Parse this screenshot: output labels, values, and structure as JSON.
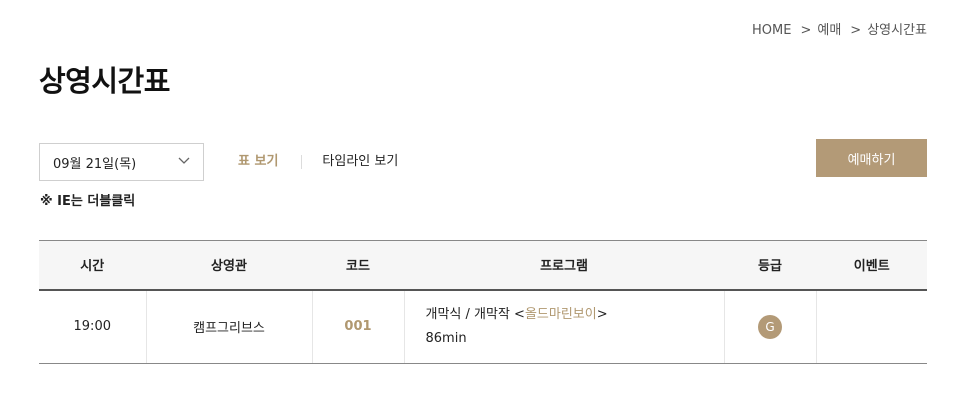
{
  "breadcrumb": {
    "items": [
      "HOME",
      "예매",
      "상영시간표"
    ],
    "separator": ">"
  },
  "page": {
    "title": "상영시간표"
  },
  "controls": {
    "date_value": "09월 21일(목)",
    "tabs": [
      {
        "label": "표 보기",
        "active": true
      },
      {
        "label": "타임라인 보기",
        "active": false
      }
    ],
    "ie_note": "※ IE는 더블클릭",
    "reserve_label": "예매하기"
  },
  "table": {
    "headers": [
      "시간",
      "상영관",
      "코드",
      "프로그램",
      "등급",
      "이벤트"
    ],
    "rows": [
      {
        "time": "19:00",
        "venue": "캠프그리브스",
        "code": "001",
        "program_prefix": "개막식 / 개막작 <",
        "program_title": "올드마린보이",
        "program_suffix": ">",
        "duration": "86min",
        "grade": "G",
        "event": ""
      }
    ]
  },
  "colors": {
    "accent": "#b39a77",
    "accent_text": "#b09870",
    "header_bg": "#f6f6f6"
  },
  "icons": {
    "date_dropdown": "chevron-down-icon",
    "grade": "grade-badge-icon"
  }
}
